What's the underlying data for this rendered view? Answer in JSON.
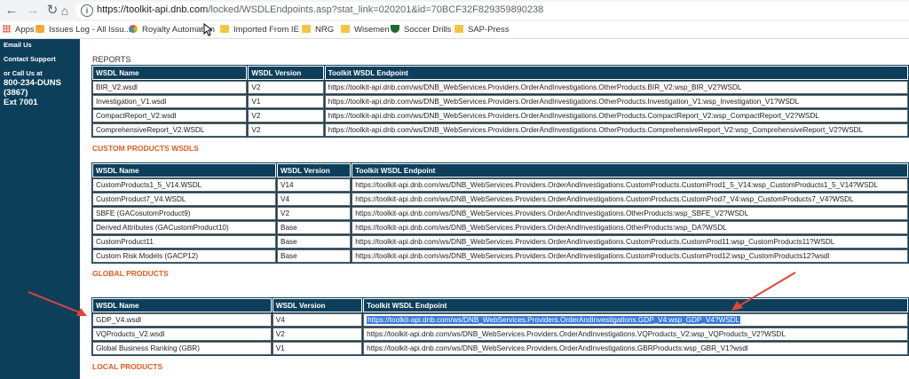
{
  "browser": {
    "url_host": "https://toolkit-api.dnb.com",
    "url_path": "/locked/WSDLEndpoints.asp?stat_link=020201&id=70BCF32F829359890238",
    "bookmarks": [
      {
        "label": "Apps"
      },
      {
        "label": "Issues Log - All Issu..."
      },
      {
        "label": "Royalty Automation"
      },
      {
        "label": "Imported From IE"
      },
      {
        "label": "NRG"
      },
      {
        "label": "Wisemen"
      },
      {
        "label": "Soccer Drills"
      },
      {
        "label": "SAP-Press"
      }
    ]
  },
  "sidebar": {
    "email": "Email Us",
    "contact": "Contact Support",
    "call": "or Call Us at",
    "phone1": "800-234-DUNS",
    "phone2": "(3867)",
    "phone3": "Ext 7001"
  },
  "headers": {
    "name": "WSDL Name",
    "version": "WSDL Version",
    "endpoint": "Toolkit WSDL Endpoint"
  },
  "reports": {
    "title": "REPORTS",
    "rows": [
      [
        "BIR_V2.wsdl",
        "V2",
        "https://toolkit-api.dnb.com/ws/DNB_WebServices.Providers.OrderAndInvestigations.OtherProducts.BIR_V2:wsp_BIR_V2?WSDL"
      ],
      [
        "Investigation_V1.wsdl",
        "V1",
        "https://toolkit-api.dnb.com/ws/DNB_WebServices.Providers.OrderAndInvestigations.OtherProducts.Investigation_V1:wsp_Investigation_V1?WSDL"
      ],
      [
        "CompactReport_V2.wsdl",
        "V2",
        "https://toolkit-api.dnb.com/ws/DNB_WebServices.Providers.OrderAndInvestigations.OtherProducts.CompactReport_V2:wsp_CompactReport_V2?WSDL"
      ],
      [
        "ComprehensiveReport_V2.WSDL",
        "V2",
        "https://toolkit-api.dnb.com/ws/DNB_WebServices.Providers.OrderAndInvestigations.OtherProducts.ComprehensiveReport_V2:wsp_ComprehensiveReport_V2?WSDL"
      ]
    ]
  },
  "custom": {
    "title": "CUSTOM PRODUCTS WSDLS",
    "rows": [
      [
        "CustomProducts1_5_V14.WSDL",
        "V14",
        "https://toolkit-api.dnb.com/ws/DNB_WebServices.Providers.OrderAndInvestigations.CustomProducts.CustomProd1_5_V14:wsp_CustomProducts1_5_V14?WSDL"
      ],
      [
        "CustomProduct7_V4.WSDL",
        "V4",
        "https://toolkit-api.dnb.com/ws/DNB_WebServices.Providers.OrderAndInvestigations.CustomProducts.CustomProd7_V4:wsp_CustomProducts7_V4?WSDL"
      ],
      [
        "SBFE (GACosutomProduct9)",
        "V2",
        "https://toolkit-api.dnb.com/ws/DNB_WebServices.Providers.OrderAndInvestigations.OtherProducts:wsp_SBFE_V2?WSDL"
      ],
      [
        "Derived Attributes (GACustomProduct10)",
        "Base",
        "https://toolkit-api.dnb.com/ws/DNB_WebServices.Providers.OrderAndInvestigations.OtherProducts:wsp_DA?WSDL"
      ],
      [
        "CustomProduct11",
        "Base",
        "https://toolkit-api.dnb.com/ws/DNB_WebServices.Providers.OrderAndInvestigations.CustomProducts.CustomProd11:wsp_CustomProducts11?WSDL"
      ],
      [
        "Custom Risk Models (GACP12)",
        "Base",
        "https://toolkit-api.dnb.com/ws/DNB_WebServices.Providers.OrderAndInvestigations.CustomProducts.CustomProd12:wsp_CustomProducts12?wsdl"
      ]
    ]
  },
  "global": {
    "title": "GLOBAL PRODUCTS",
    "rows": [
      [
        "GDP_V4.wsdl",
        "V4",
        "https://toolkit-api.dnb.com/ws/DNB_WebServices.Providers.OrderAndInvestigations.GDP_V4:wsp_GDP_V4?WSDL"
      ],
      [
        "VQProducts_V2.wsdl",
        "V2",
        "https://toolkit-api.dnb.com/ws/DNB_WebServices.Providers.OrderAndInvestigations.VQProducts_V2:wsp_VQProducts_V2?WSDL"
      ],
      [
        "Global Business Ranking (GBR)",
        "V1",
        "https://toolkit-api.dnb.com/ws/DNB_WebServices.Providers.OrderAndInvestigations.GBRProducts:wsp_GBR_V1?wsdl"
      ]
    ]
  },
  "local": {
    "title": "LOCAL PRODUCTS"
  }
}
